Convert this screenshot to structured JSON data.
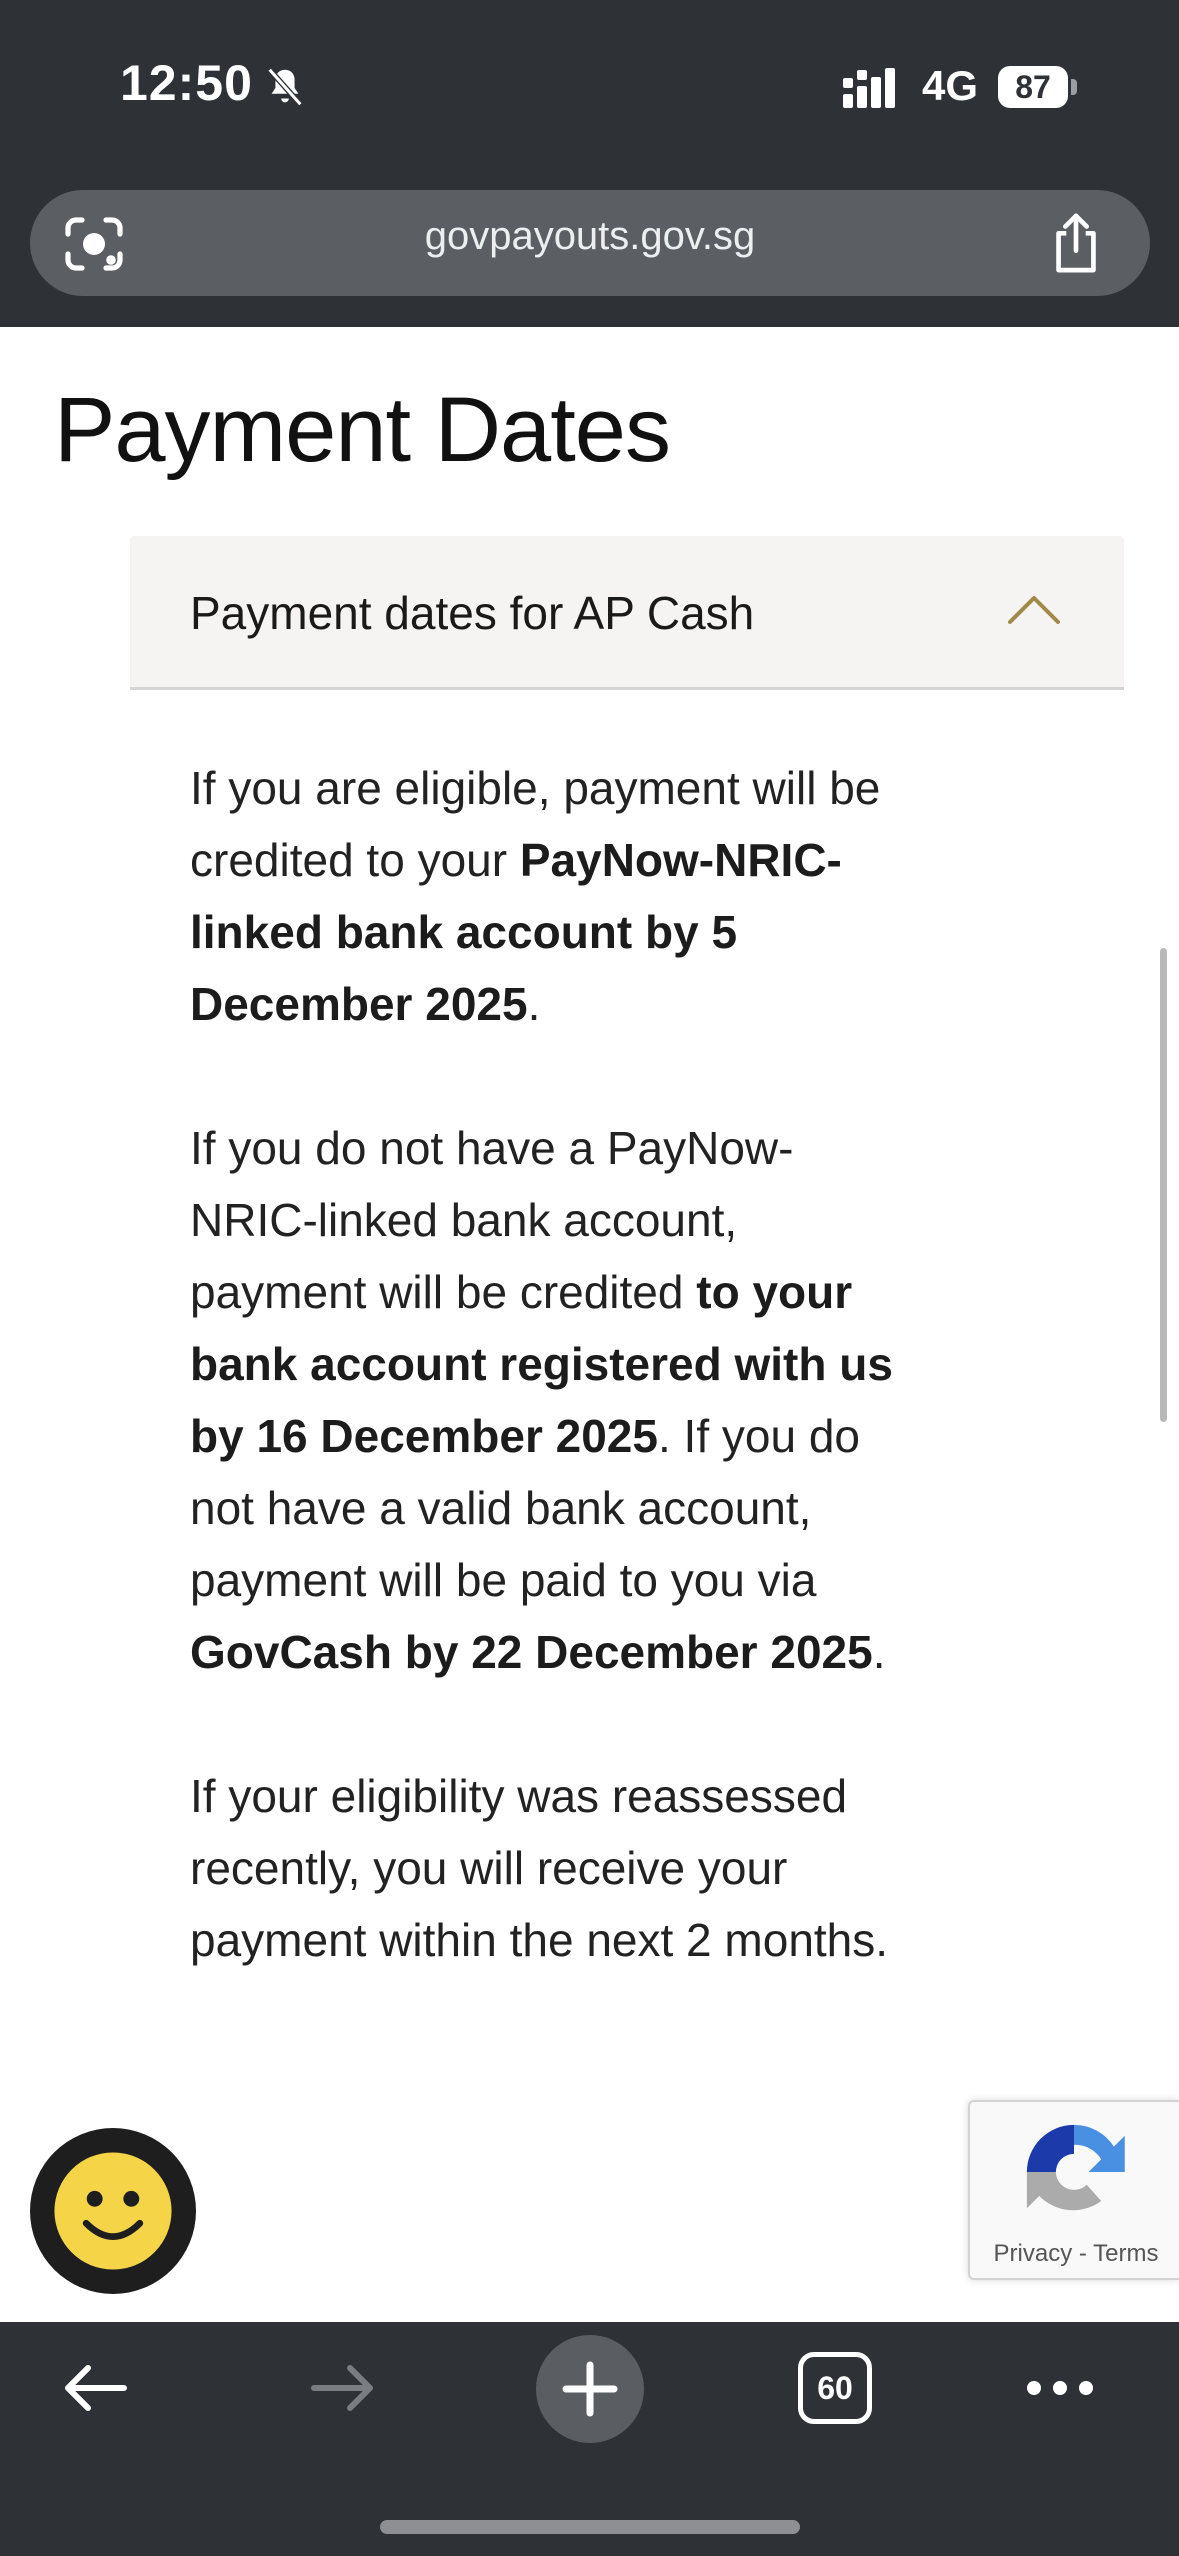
{
  "status_bar": {
    "time": "12:50",
    "network": "4G",
    "battery": "87",
    "icons": [
      "bell-muted-icon",
      "signal-icon"
    ]
  },
  "browser": {
    "url": "govpayouts.gov.sg",
    "open_tabs": "60",
    "icons": [
      "lens-icon",
      "share-icon",
      "back-icon",
      "forward-icon",
      "plus-icon",
      "more-icon"
    ]
  },
  "page": {
    "title": "Payment Dates",
    "accordion": {
      "title": "Payment dates for AP Cash",
      "expanded": true,
      "paragraph1": {
        "t1": "If you are eligible, payment will be credited to your ",
        "b1": "PayNow-NRIC-linked bank account by 5 December 2025",
        "t2": "."
      },
      "paragraph2": {
        "t1": "If you do not have a PayNow-NRIC-linked bank account, payment will be credited ",
        "b1": "to your bank account registered with us by 16 December 2025",
        "t2": ". If you do not have a valid bank account, payment will be paid to you via ",
        "b2": "GovCash by 22 December 2025",
        "t3": "."
      },
      "paragraph3": "If your eligibility was reassessed recently, you will receive your payment within the next 2 months."
    }
  },
  "recaptcha": {
    "privacy": "Privacy",
    "separator": " - ",
    "terms": "Terms"
  },
  "colors": {
    "chrome": "#2e3135",
    "urlbar": "#5b5f63",
    "accent_gold": "#a08a48",
    "smiley_yellow": "#f5d547"
  }
}
